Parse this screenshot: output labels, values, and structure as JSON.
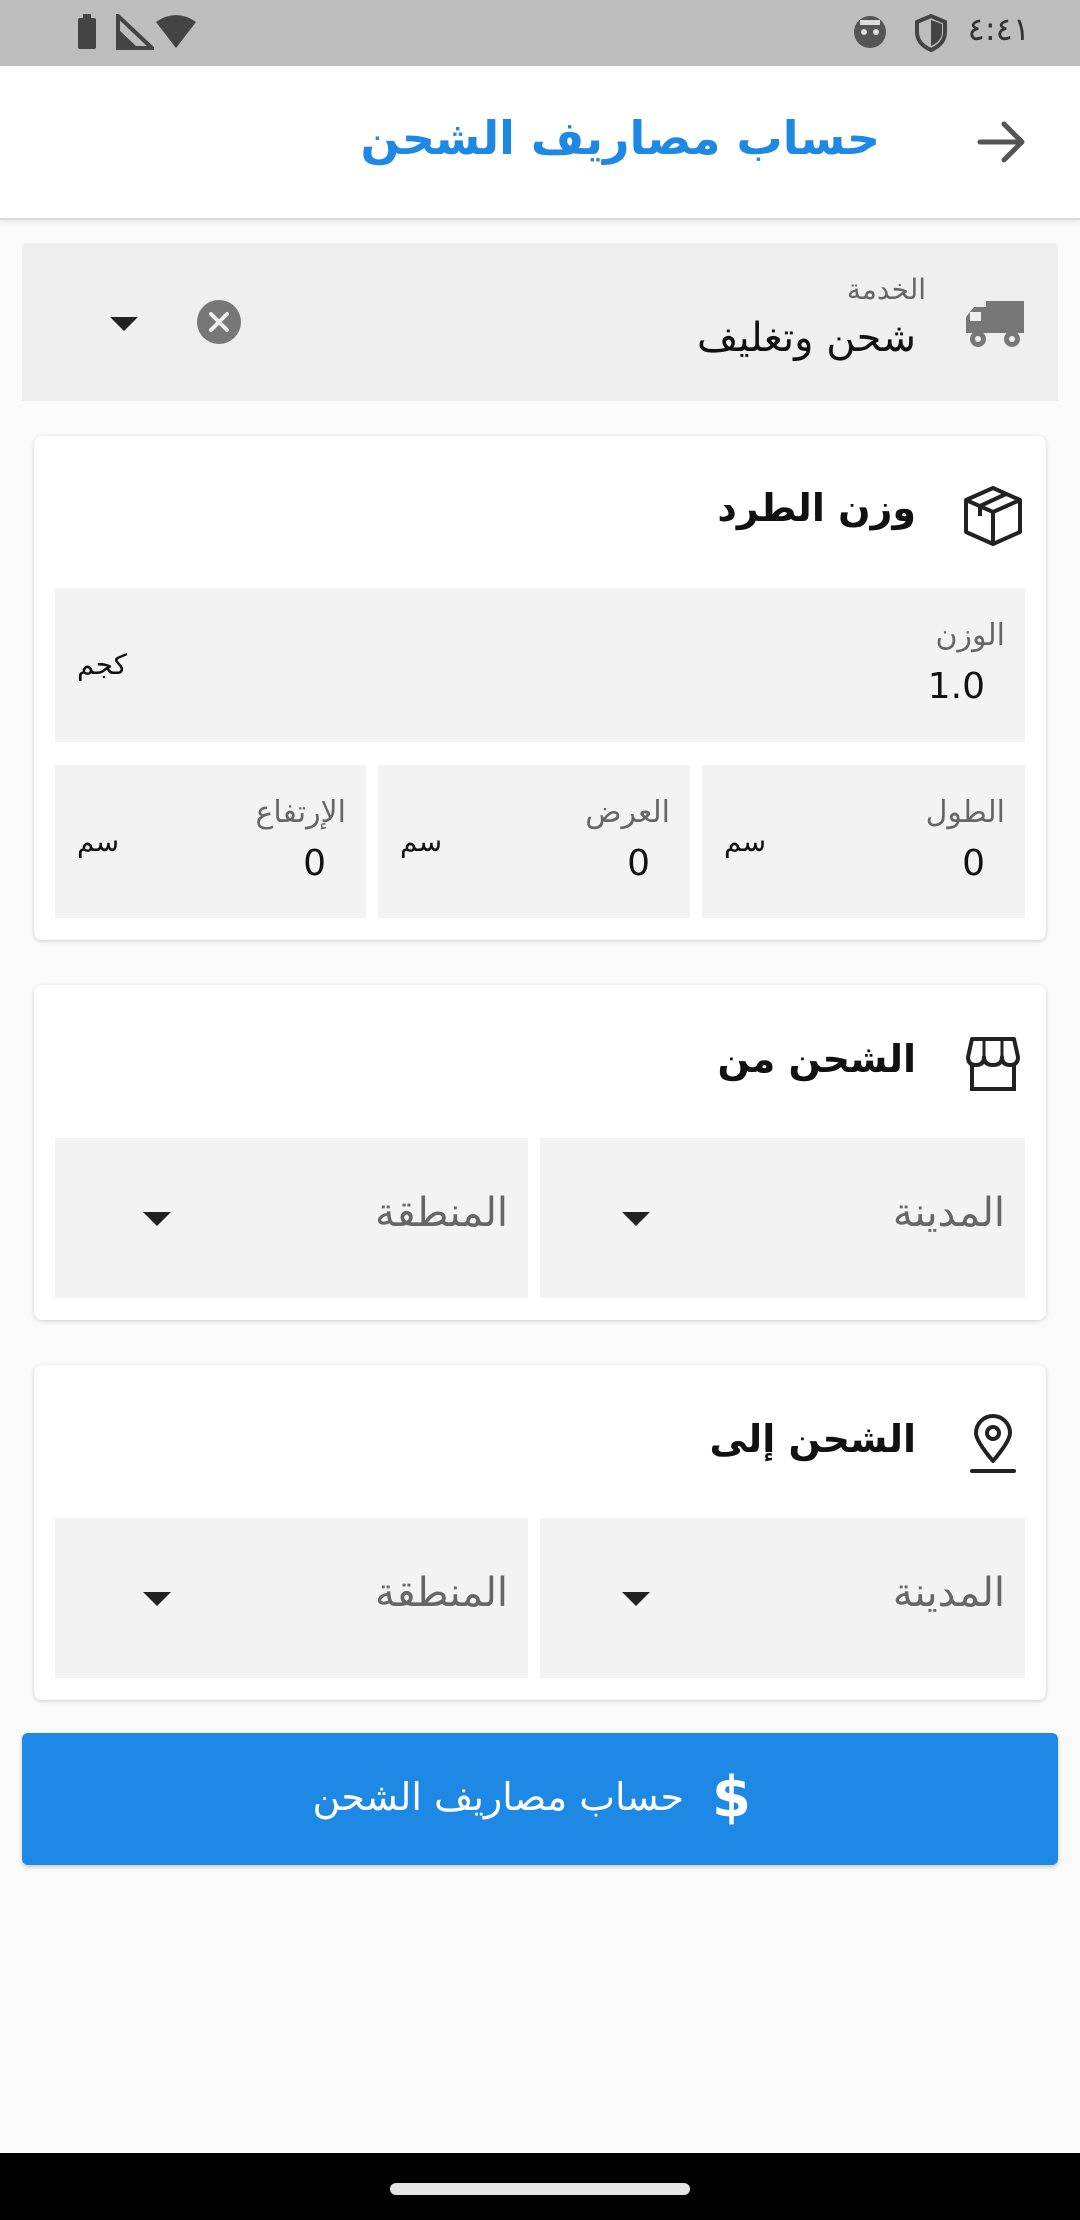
{
  "status_bar": {
    "time": "٤:٤١",
    "icons": [
      "battery-icon",
      "signal-icon",
      "wifi-icon",
      "face-icon",
      "shield-icon"
    ]
  },
  "app_bar": {
    "title": "حساب مصاريف الشحن",
    "back_icon": "arrow-right-icon"
  },
  "service": {
    "label": "الخدمة",
    "value": "شحن وتغليف",
    "icons": [
      "truck-icon",
      "clear-icon",
      "dropdown-arrow-icon"
    ]
  },
  "package_weight": {
    "title": "وزن الطرد",
    "icon": "box-icon",
    "weight": {
      "label": "الوزن",
      "value": "1.0",
      "unit": "كجم"
    },
    "length": {
      "label": "الطول",
      "value": "0",
      "unit": "سم"
    },
    "width": {
      "label": "العرض",
      "value": "0",
      "unit": "سم"
    },
    "height": {
      "label": "الإرتفاع",
      "value": "0",
      "unit": "سم"
    }
  },
  "ship_from": {
    "title": "الشحن من",
    "icon": "store-icon",
    "city_placeholder": "المدينة",
    "area_placeholder": "المنطقة"
  },
  "ship_to": {
    "title": "الشحن إلى",
    "icon": "location-pin-icon",
    "city_placeholder": "المدينة",
    "area_placeholder": "المنطقة"
  },
  "calculate_button": {
    "label": "حساب مصاريف الشحن",
    "icon_glyph": "$"
  },
  "colors": {
    "primary": "#1e88e5",
    "status_bar": "#bdbdbd",
    "field_bg": "#f3f3f3",
    "background": "#fafafa"
  }
}
